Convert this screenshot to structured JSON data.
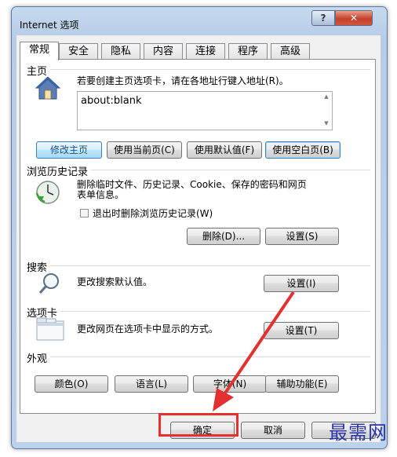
{
  "window": {
    "title": "Internet 选项",
    "help_glyph": "?",
    "close_glyph": "✕"
  },
  "tabs": [
    {
      "label": "常规",
      "active": true
    },
    {
      "label": "安全"
    },
    {
      "label": "隐私"
    },
    {
      "label": "内容"
    },
    {
      "label": "连接"
    },
    {
      "label": "程序"
    },
    {
      "label": "高级"
    }
  ],
  "homepage": {
    "group_label": "主页",
    "instruction": "若要创建主页选项卡，请在各地址行键入地址(R)。",
    "address_value": "about:blank",
    "buttons": {
      "modify": "修改主页",
      "use_current": "使用当前页(C)",
      "use_default": "使用默认值(F)",
      "use_blank": "使用空白页(B)"
    }
  },
  "history": {
    "group_label": "浏览历史记录",
    "description_line1": "删除临时文件、历史记录、Cookie、保存的密码和网页",
    "description_line2": "表单信息。",
    "checkbox_label": "退出时删除浏览历史记录(W)",
    "delete_button": "删除(D)...",
    "settings_button": "设置(S)"
  },
  "search": {
    "group_label": "搜索",
    "description": "更改搜索默认值。",
    "settings_button": "设置(I)"
  },
  "tabs_section": {
    "group_label": "选项卡",
    "description": "更改网页在选项卡中显示的方式。",
    "settings_button": "设置(T)"
  },
  "appearance": {
    "group_label": "外观",
    "colors_button": "颜色(O)",
    "languages_button": "语言(L)",
    "fonts_button": "字体(N)",
    "accessibility_button": "辅助功能(E)"
  },
  "footer": {
    "ok_button": "确定",
    "cancel_button": "取消"
  },
  "watermark": "最需网",
  "colors": {
    "annotation_red": "#e33131",
    "watermark_blue": "#2a32a8"
  }
}
